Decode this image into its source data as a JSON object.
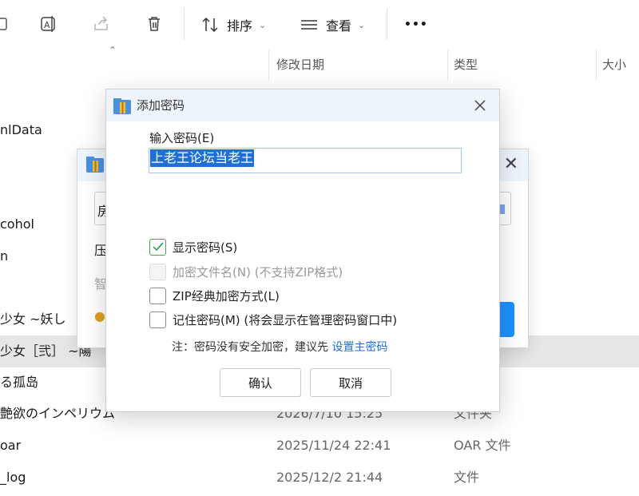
{
  "toolbar": {
    "sort_label": "排序",
    "view_label": "查看",
    "more_label": "•••"
  },
  "columns": {
    "modified": "修改日期",
    "type": "类型",
    "size": "大小"
  },
  "files": [
    {
      "name": "nlData",
      "date": "",
      "type": ""
    },
    {
      "name": "cohol",
      "date": "",
      "type": ""
    },
    {
      "name": "n",
      "date": "",
      "type": ""
    },
    {
      "name": "少女 ~妖し",
      "date": "",
      "type": ""
    },
    {
      "name": "少女［弐］ ~陽",
      "date": "",
      "type": ""
    },
    {
      "name": "る孤岛",
      "date": "",
      "type": ""
    },
    {
      "name": "艶欲のインペリウム",
      "date": "2026/7/10 15:25",
      "type": "文件夹"
    },
    {
      "name": "oar",
      "date": "2025/11/24 22:41",
      "type": "OAR 文件"
    },
    {
      "name": "_log",
      "date": "2025/12/2 21:44",
      "type": "文件"
    }
  ],
  "background_dialog": {
    "frag_1": "房",
    "frag_2": "压",
    "frag_3": "智"
  },
  "dialog": {
    "title": "添加密码",
    "password_label": "输入密码(E)",
    "password_value": "上老王论坛当老王",
    "options": [
      {
        "label": "显示密码(S)",
        "checked": true,
        "disabled": false
      },
      {
        "label": "加密文件名(N) (不支持ZIP格式)",
        "checked": false,
        "disabled": true
      },
      {
        "label": "ZIP经典加密方式(L)",
        "checked": false,
        "disabled": false
      },
      {
        "label": "记住密码(M) (将会显示在管理密码窗口中)",
        "checked": false,
        "disabled": false
      }
    ],
    "note_text": "注：密码没有安全加密，建议先 ",
    "note_link": "设置主密码",
    "confirm_label": "确认",
    "cancel_label": "取消"
  },
  "colors": {
    "accent": "#1f6fd6",
    "titlebar": "#eef4fc",
    "check": "#3aa657"
  }
}
